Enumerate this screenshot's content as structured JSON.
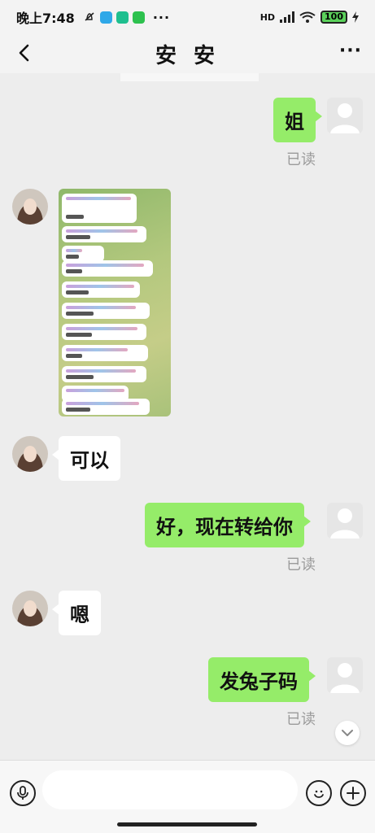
{
  "status_bar": {
    "time": "晚上7:48",
    "network": "HD",
    "battery": "100",
    "more": "···"
  },
  "header": {
    "title": "安 安",
    "more": "···"
  },
  "messages": [
    {
      "side": "me",
      "text": "姐",
      "status": "已读"
    },
    {
      "side": "other",
      "type": "image"
    },
    {
      "side": "other",
      "text": "可以"
    },
    {
      "side": "me",
      "text": "好，现在转给你",
      "status": "已读"
    },
    {
      "side": "other",
      "text": "嗯"
    },
    {
      "side": "me",
      "text": "发兔子码",
      "status": "已读"
    }
  ],
  "colors": {
    "bubble_me": "#95ec69",
    "bubble_other": "#ffffff",
    "background": "#ededed",
    "read_text": "#9b9b9b"
  },
  "icons": [
    "back-icon",
    "more-icon",
    "voice-icon",
    "emoji-icon",
    "add-icon",
    "chevron-down-icon"
  ]
}
